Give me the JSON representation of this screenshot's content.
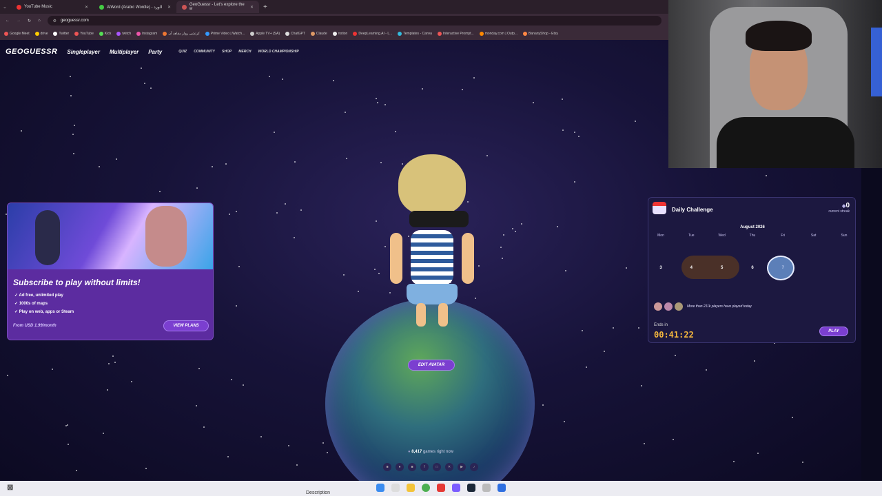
{
  "browser": {
    "tabs": [
      {
        "label": "YouTube Music"
      },
      {
        "label": "AlWord (Arabic Wordle) - الورد"
      },
      {
        "label": "GeoGuessr - Let's explore the w"
      }
    ],
    "url": "geoguessr.com",
    "bookmarks": [
      "Google Meet",
      "drive",
      "Twitter",
      "YouTube",
      "Kick",
      "twitch",
      "Instagram",
      "كرتشي رولز مقاهد آن",
      "Prime Video | Watch...",
      "Apple TV+ (SA)",
      "ChatGPT",
      "Claude",
      "notion",
      "DeepLearning.AI - L...",
      "Templates - Canva",
      "Interactive Prompt...",
      "monday.com | Outp...",
      "BananyShop - Etsy"
    ]
  },
  "nav": {
    "logo": "GEOGUESSR",
    "main": [
      "Singleplayer",
      "Multiplayer",
      "Party"
    ],
    "small": [
      "QUIZ",
      "COMMUNITY",
      "SHOP",
      "MERCH",
      "WORLD CHAMPIONSHIP"
    ]
  },
  "subscribe": {
    "title": "Subscribe to play without limits!",
    "features": [
      "Ad free, unlimited play",
      "1000s of maps",
      "Play on web, apps or Steam"
    ],
    "price": "From USD 1.99/month",
    "button": "VIEW PLANS"
  },
  "avatar": {
    "button": "EDIT AVATAR"
  },
  "status": {
    "count": "8,417",
    "suffix": "games right now"
  },
  "daily": {
    "title": "Daily Challenge",
    "streak": "0",
    "streak_label": "current streak",
    "month": "August 2026",
    "days": [
      "Mon",
      "Tue",
      "Wed",
      "Thu",
      "Fri",
      "Sat",
      "Sun"
    ],
    "week": [
      "3",
      "4",
      "5",
      "6",
      "7",
      "",
      ""
    ],
    "players_text": "More than 211k players have played today",
    "ends_label": "Ends in",
    "time": "00:41:22",
    "play": "PLAY"
  },
  "taskbar": {
    "description": "Description"
  },
  "colors": {
    "accent": "#7b3fd0",
    "timer": "#f3b63d",
    "background": "#171339"
  }
}
